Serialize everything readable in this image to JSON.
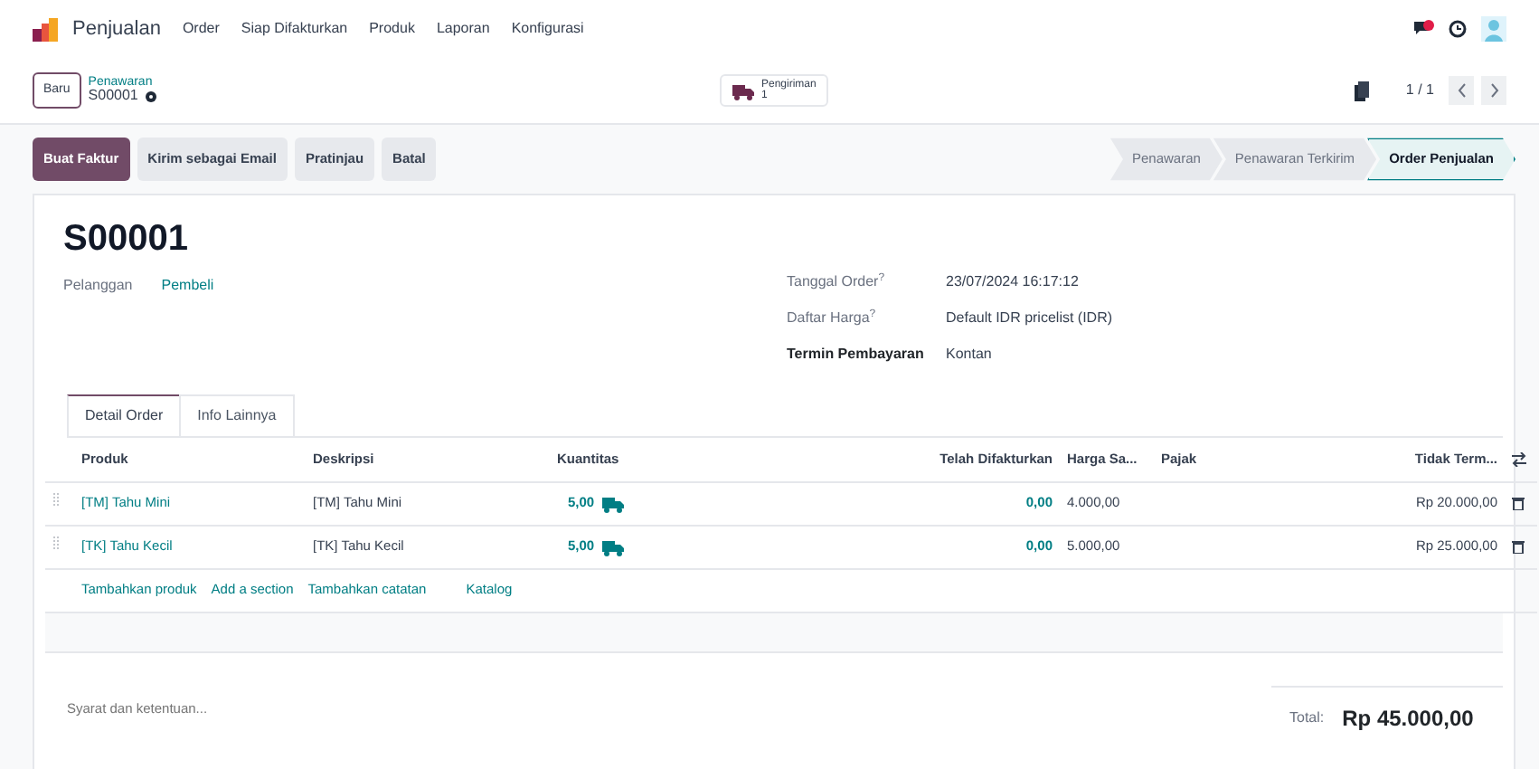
{
  "app": {
    "name": "Penjualan",
    "menu": [
      "Order",
      "Siap Difakturkan",
      "Produk",
      "Laporan",
      "Konfigurasi"
    ]
  },
  "control": {
    "new_button": "Baru",
    "breadcrumb": "Penawaran",
    "record": "S00001",
    "smart_button": {
      "label": "Pengiriman",
      "count": "1"
    },
    "pager": "1 / 1"
  },
  "actions": [
    {
      "label": "Buat Faktur",
      "kind": "primary"
    },
    {
      "label": "Kirim sebagai Email",
      "kind": "secondary"
    },
    {
      "label": "Pratinjau",
      "kind": "secondary"
    },
    {
      "label": "Batal",
      "kind": "secondary"
    }
  ],
  "stages": [
    {
      "label": "Penawaran",
      "selected": false
    },
    {
      "label": "Penawaran Terkirim",
      "selected": false
    },
    {
      "label": "Order Penjualan",
      "selected": true
    }
  ],
  "form": {
    "title": "S00001",
    "customer": {
      "label": "Pelanggan",
      "value": "Pembeli"
    },
    "fields": [
      {
        "label": "Tanggal Order$^{?}$",
        "value": "23/07/2024 16:17:12",
        "emphasized": false
      },
      {
        "label": "Daftar Harga$^{?}$",
        "value": "Default IDR pricelist (IDR)",
        "emphasized": false
      },
      {
        "label": "Termin Pembayaran",
        "value": "Kontan",
        "emphasized": true
      }
    ]
  },
  "tabs": [
    {
      "label": "Detail Order",
      "selected": true
    },
    {
      "label": "Info Lainnya",
      "selected": false
    }
  ],
  "table": {
    "columns": [
      "Produk",
      "Deskripsi",
      "Kuantitas",
      "Telah Difakturkan",
      "Harga Sa...",
      "Pajak",
      "Tidak Term..."
    ],
    "rows": [
      {
        "product": "[TM] Tahu Mini",
        "description": "[TM] Tahu Mini",
        "quantity": "5,00",
        "invoiced": "0,00",
        "price": "4.000,00",
        "subtotal": "Rp 20.000,00"
      },
      {
        "product": "[TK] Tahu Kecil",
        "description": "[TK] Tahu Kecil",
        "quantity": "5,00",
        "invoiced": "0,00",
        "price": "5.000,00",
        "subtotal": "Rp 25.000,00"
      }
    ]
  },
  "add_links": [
    "Tambahkan produk",
    "Add a section",
    "Tambahkan catatan",
    "Katalog"
  ],
  "note": {
    "placeholder": "Syarat dan ketentuan..."
  },
  "total": {
    "label": "Total:",
    "value": "Rp 45.000,00"
  }
}
